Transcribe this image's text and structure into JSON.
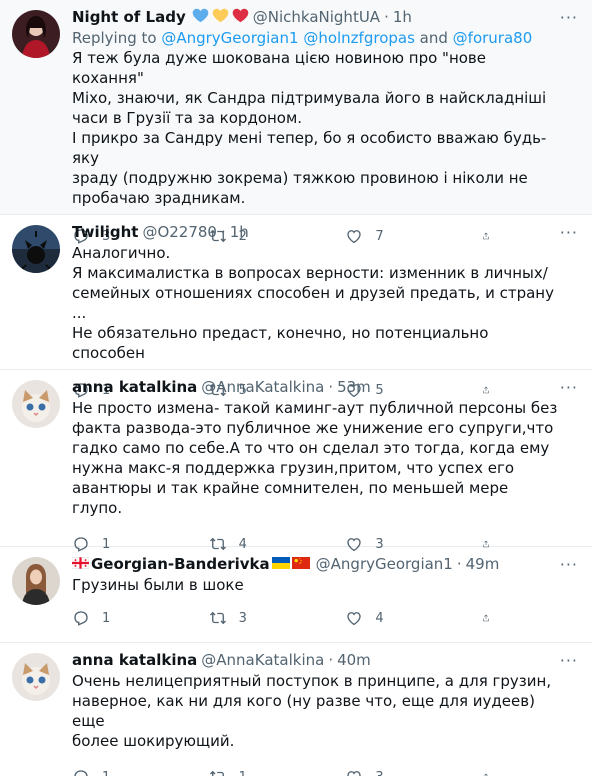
{
  "tweets": [
    {
      "name": "Night of Lady",
      "handle": "@NichkaNightUA",
      "time": "1h",
      "reply_prefix": "Replying to ",
      "mentions": [
        "@AngryGeorgian1",
        "@holnzfgropas"
      ],
      "reply_and": " and ",
      "mention_last": "@forura80",
      "text": "Я теж була дуже шокована цією новиною про \"нове кохання\"\nМіхо, знаючи, як Сандра підтримувала його в найскладніші\nчаси в Грузії та за кордоном.\nІ прикро за Сандру мені тепер, бо я особисто вважаю будь-яку\nзраду (подружню зокрема) тяжкою провиною і ніколи не\nпробачаю зрадникам.",
      "replies": "3",
      "retweets": "2",
      "likes": "7"
    },
    {
      "name": "Twilight",
      "handle": "@O22780",
      "time": "1h",
      "text": "Аналогично.\nЯ максималистка в вопросах верности: изменник в личных/\nсемейных отношениях способен и друзей предать, и страну ...\nНе обязательно предаст, конечно, но потенциально способен",
      "replies": "1",
      "retweets": "5",
      "likes": "5"
    },
    {
      "name": "anna katalkina",
      "handle": "@AnnaKatalkina",
      "time": "53m",
      "text": "Не просто измена- такой каминг-аут публичной персоны без\nфакта развода-это публичное же унижение его супруги,что\nгадко само по себе.А то что он сделал это тогда, когда ему\nнужна макс-я поддержка грузин,притом, что успех его\nавантюры и так крайне сомнителен, по меньшей мере глупо.",
      "replies": "1",
      "retweets": "4",
      "likes": "3"
    },
    {
      "name": "Georgian-Banderivka",
      "handle": "@AngryGeorgian1",
      "time": "49m",
      "text": "Грузины были в шоке",
      "replies": "1",
      "retweets": "3",
      "likes": "4"
    },
    {
      "name": "anna katalkina",
      "handle": "@AnnaKatalkina",
      "time": "40m",
      "text": "Очень нелицеприятный поступок в принципе, а для грузин,\nнаверное, как ни для кого (ну разве что, еще для иудеев) еще\nболее шокирующий.",
      "replies": "1",
      "retweets": "1",
      "likes": "3"
    }
  ],
  "icons": {
    "verified_hearts": [
      "blue-heart",
      "yellow-heart",
      "red-heart"
    ],
    "flags": [
      "georgia-flag",
      "ukraine-flag",
      "china-flag"
    ]
  },
  "colors": {
    "accent": "#1d9bf0",
    "muted": "#536471",
    "border": "#e6ecf0",
    "highlight_bg": "#f7f9fa"
  },
  "more_label": "···",
  "dot": "·"
}
